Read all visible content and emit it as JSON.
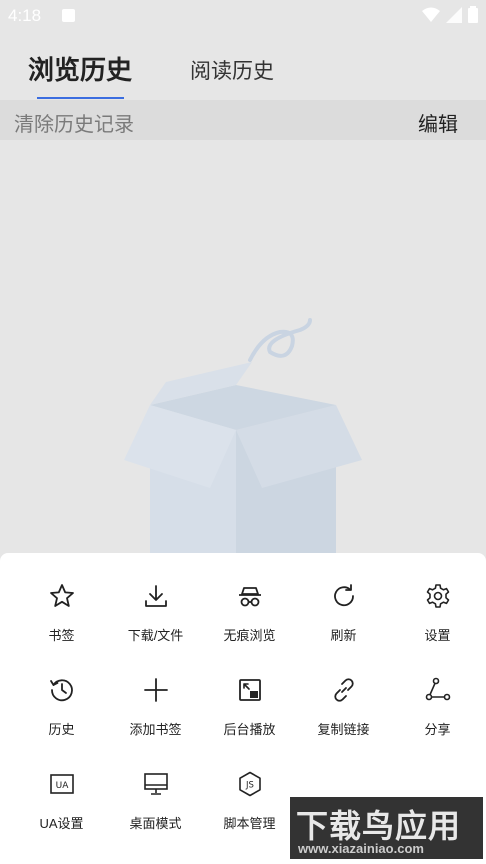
{
  "status_bar": {
    "time": "4:18"
  },
  "tabs": [
    {
      "label": "浏览历史",
      "active": true
    },
    {
      "label": "阅读历史",
      "active": false
    }
  ],
  "toolbar": {
    "clear_label": "清除历史记录",
    "edit_label": "编辑"
  },
  "menu": {
    "items": [
      {
        "label": "书签",
        "icon": "star-icon"
      },
      {
        "label": "下载/文件",
        "icon": "download-icon"
      },
      {
        "label": "无痕浏览",
        "icon": "incognito-icon"
      },
      {
        "label": "刷新",
        "icon": "refresh-icon"
      },
      {
        "label": "设置",
        "icon": "gear-icon"
      },
      {
        "label": "历史",
        "icon": "clock-icon"
      },
      {
        "label": "添加书签",
        "icon": "plus-icon"
      },
      {
        "label": "后台播放",
        "icon": "pip-icon"
      },
      {
        "label": "复制链接",
        "icon": "link-icon"
      },
      {
        "label": "分享",
        "icon": "share-icon"
      },
      {
        "label": "UA设置",
        "icon": "ua-icon",
        "icon_text": "UA"
      },
      {
        "label": "桌面模式",
        "icon": "monitor-icon"
      },
      {
        "label": "脚本管理",
        "icon": "js-icon",
        "icon_text": "JS"
      }
    ]
  },
  "watermark": {
    "main": "下载鸟应用",
    "sub": "www.xiazainiao.com"
  },
  "colors": {
    "accent": "#3b6de0",
    "background": "#e6e6e6",
    "sheet": "#ffffff"
  }
}
